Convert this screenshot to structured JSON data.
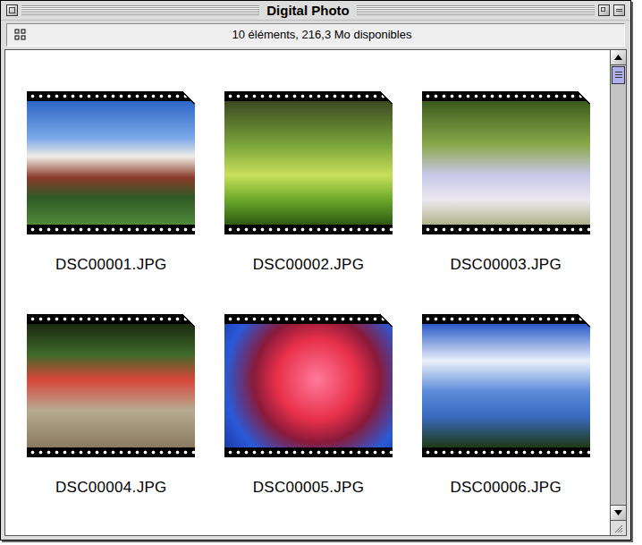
{
  "window": {
    "title": "Digital Photo"
  },
  "info_bar": {
    "text": "10 éléments, 216,3 Mo disponibles"
  },
  "files": [
    {
      "name": "DSC00001.JPG"
    },
    {
      "name": "DSC00002.JPG"
    },
    {
      "name": "DSC00003.JPG"
    },
    {
      "name": "DSC00004.JPG"
    },
    {
      "name": "DSC00005.JPG"
    },
    {
      "name": "DSC00006.JPG"
    }
  ],
  "scrollbar": {
    "level": 0
  }
}
